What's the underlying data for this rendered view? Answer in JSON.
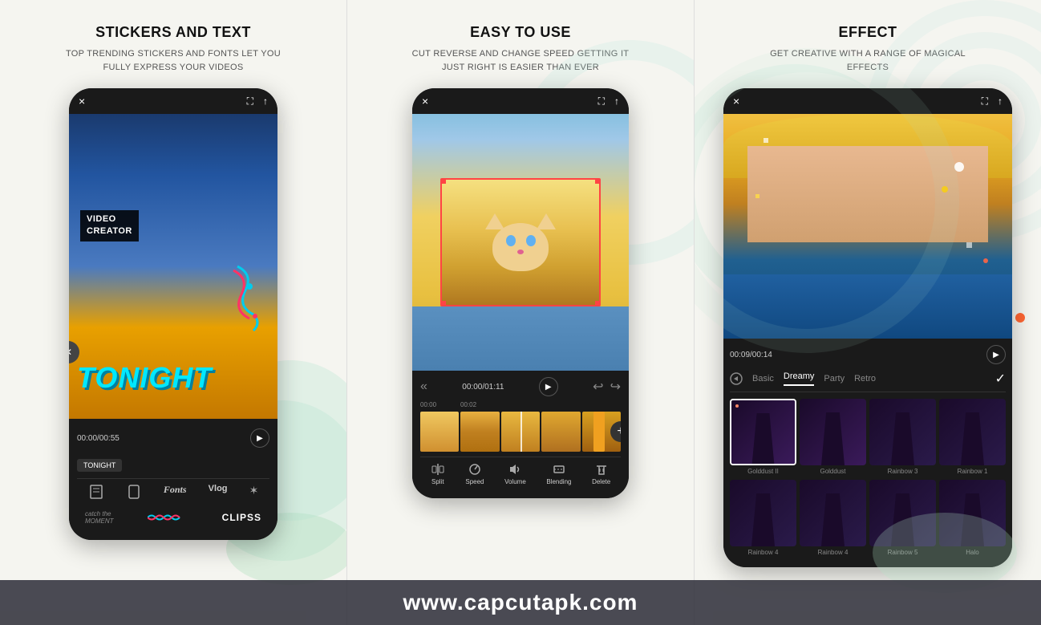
{
  "panels": [
    {
      "id": "stickers",
      "heading": "STICKERS AND TEXT",
      "subtext": "TOP TRENDING STICKERS AND FONTS LET YOU FULLY EXPRESS YOUR VIDEOS",
      "phone": {
        "topbar": {
          "close": "×",
          "expand": "⛶",
          "share": "↑"
        },
        "videoLabel": "VIDEO\nCREATOR",
        "tonightText": "TONIGHT",
        "tonightChip": "TONIGHT",
        "timeDisplay": "00:00/00:55",
        "toolbarItems": [
          "≡",
          "⬜",
          "Fonts",
          "Vlog",
          "✶"
        ],
        "footerLogoText": "CLIPSS"
      }
    },
    {
      "id": "easy",
      "heading": "EASY TO USE",
      "subtext": "CUT REVERSE AND CHANGE SPEED GETTING IT JUST RIGHT IS EASIER THAN EVER",
      "phone": {
        "topbar": {
          "close": "×",
          "expand": "⛶",
          "share": "↑"
        },
        "timeDisplay": "00:00/01:11",
        "timelineLabels": [
          "00:00",
          "00:02"
        ],
        "toolbarItems": [
          "Split",
          "Speed",
          "Volume",
          "Blending",
          "Delete"
        ]
      }
    },
    {
      "id": "effect",
      "heading": "EFFECT",
      "subtext": "GET CREATIVE WITH A RANGE OF MAGICAL EFFECTS",
      "phone": {
        "topbar": {
          "close": "×",
          "expand": "⛶",
          "share": "↑"
        },
        "timeDisplay": "00:09/00:14",
        "effectTabs": [
          "Basic",
          "Dreamy",
          "Party",
          "Retro"
        ],
        "activeTab": "Dreamy",
        "effectRow1": [
          "Golddust II",
          "Golddust",
          "Rainbow 3",
          "Rainbow 1"
        ],
        "effectRow2": [
          "Rainbow 4",
          "Rainbow 4",
          "Rainbow 5",
          "Halo"
        ]
      }
    }
  ],
  "watermark": "www.capcutapk.com"
}
